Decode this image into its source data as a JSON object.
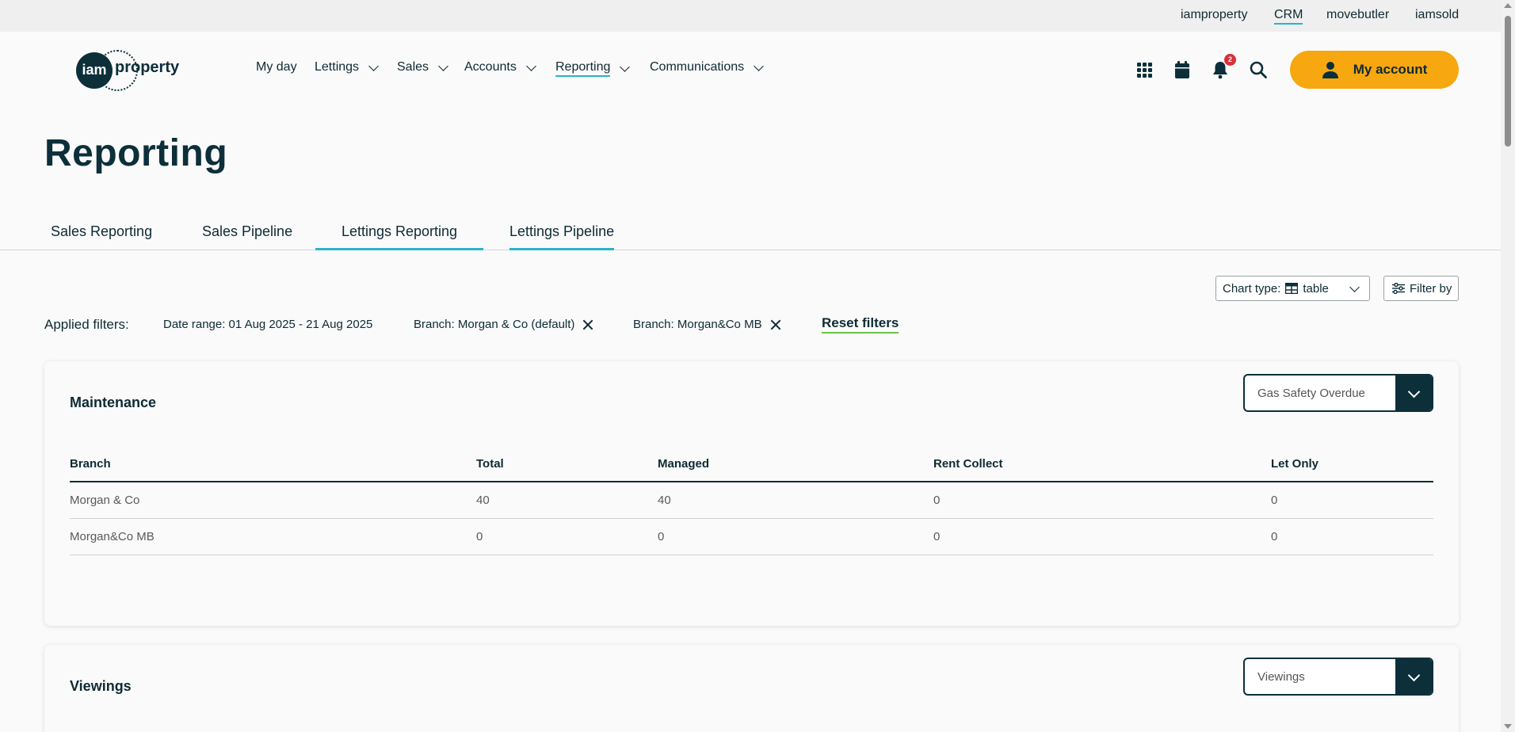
{
  "topbar": {
    "links": [
      "iamproperty",
      "CRM",
      "movebutler",
      "iamsold"
    ],
    "active": "CRM"
  },
  "logo": {
    "circle_text": "iam",
    "wordmark": "property"
  },
  "nav": {
    "my_day": "My day",
    "lettings": "Lettings",
    "sales": "Sales",
    "accounts": "Accounts",
    "reporting": "Reporting",
    "communications": "Communications"
  },
  "header_icons": {
    "apps": "apps-grid-icon",
    "calendar": "calendar-icon",
    "notifications": "bell-icon",
    "notification_count": "2",
    "search": "search-icon"
  },
  "account": {
    "label": "My account"
  },
  "page": {
    "title": "Reporting"
  },
  "tabs": {
    "sales_reporting": "Sales Reporting",
    "sales_pipeline": "Sales Pipeline",
    "lettings_reporting": "Lettings Reporting",
    "lettings_pipeline": "Lettings Pipeline",
    "active": "Lettings Reporting"
  },
  "chart_type": {
    "label": "Chart type:",
    "value": "table"
  },
  "filter_by": {
    "label": "Filter by"
  },
  "filters": {
    "applied_label": "Applied filters:",
    "date_range": "Date range: 01 Aug 2025 - 21 Aug 2025",
    "branch_1": "Branch: Morgan & Co (default)",
    "branch_2": "Branch: Morgan&Co MB",
    "reset": "Reset filters"
  },
  "maintenance": {
    "title": "Maintenance",
    "select_value": "Gas Safety Overdue",
    "columns": [
      "Branch",
      "Total",
      "Managed",
      "Rent Collect",
      "Let Only"
    ],
    "rows": [
      [
        "Morgan & Co",
        "40",
        "40",
        "0",
        "0"
      ],
      [
        "Morgan&Co MB",
        "0",
        "0",
        "0",
        "0"
      ]
    ]
  },
  "viewings": {
    "title": "Viewings",
    "select_value": "Viewings"
  },
  "colors": {
    "brand_dark": "#0c2f3a",
    "accent_teal": "#2bb3c8",
    "account_orange": "#f7a70f",
    "reset_green": "#6cc24a",
    "badge_red": "#d6323a"
  }
}
